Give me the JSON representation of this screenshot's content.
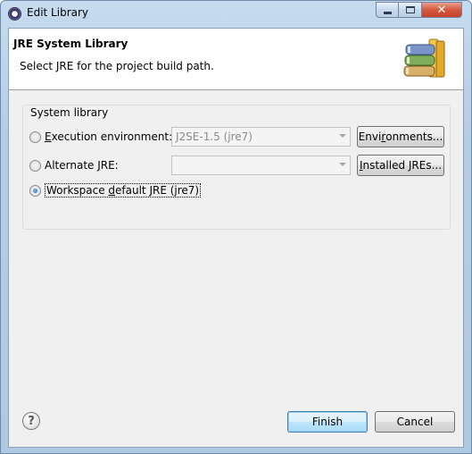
{
  "window": {
    "title": "Edit Library",
    "icon": "eclipse-icon"
  },
  "header": {
    "title": "JRE System Library",
    "description": "Select JRE for the project build path.",
    "icon": "books-library-icon"
  },
  "group": {
    "label": "System library",
    "execution_environment": {
      "label_prefix": "",
      "mnemonic": "E",
      "label_rest": "xecution environment:",
      "checked": false,
      "combo_value": "J2SE-1.5 (jre7)",
      "button_label_prefix": "Envi",
      "button_mnemonic": "r",
      "button_label_rest": "onments..."
    },
    "alternate_jre": {
      "label_prefix": "Alternate ",
      "mnemonic": "J",
      "label_rest": "RE:",
      "checked": false,
      "combo_value": "",
      "button_label_prefix": "",
      "button_mnemonic": "I",
      "button_label_rest": "nstalled JREs..."
    },
    "workspace_default": {
      "label_prefix": "Workspace ",
      "mnemonic": "d",
      "label_rest": "efault JRE (jre7)",
      "checked": true
    }
  },
  "footer": {
    "help_icon": "question-mark-icon",
    "finish_label": "Finish",
    "cancel_label": "Cancel"
  },
  "colors": {
    "title_bar": "#b4cde6",
    "close_button": "#d4593d",
    "default_button_border": "#3c7fb1"
  }
}
